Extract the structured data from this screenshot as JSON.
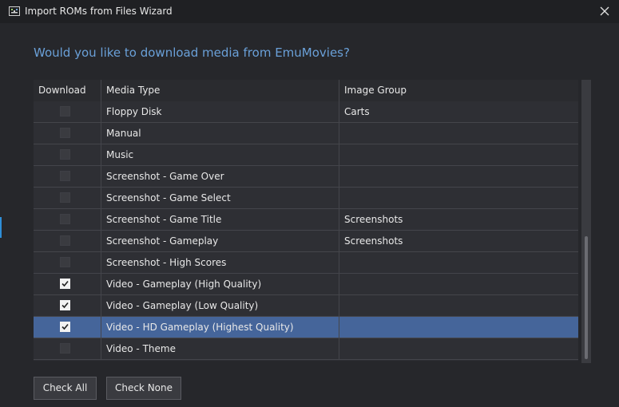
{
  "window": {
    "title": "Import ROMs from Files Wizard",
    "icon": "app-icon",
    "close_icon": "close-icon"
  },
  "question": "Would you like to download media from EmuMovies?",
  "table": {
    "columns": [
      "Download",
      "Media Type",
      "Image Group"
    ],
    "rows": [
      {
        "checked": false,
        "media_type": "Floppy Disk",
        "image_group": "Carts"
      },
      {
        "checked": false,
        "media_type": "Manual",
        "image_group": ""
      },
      {
        "checked": false,
        "media_type": "Music",
        "image_group": ""
      },
      {
        "checked": false,
        "media_type": "Screenshot - Game Over",
        "image_group": ""
      },
      {
        "checked": false,
        "media_type": "Screenshot - Game Select",
        "image_group": ""
      },
      {
        "checked": false,
        "media_type": "Screenshot - Game Title",
        "image_group": "Screenshots"
      },
      {
        "checked": false,
        "media_type": "Screenshot - Gameplay",
        "image_group": "Screenshots"
      },
      {
        "checked": false,
        "media_type": "Screenshot - High Scores",
        "image_group": ""
      },
      {
        "checked": true,
        "media_type": "Video - Gameplay (High Quality)",
        "image_group": ""
      },
      {
        "checked": true,
        "media_type": "Video - Gameplay (Low Quality)",
        "image_group": ""
      },
      {
        "checked": true,
        "media_type": "Video - HD Gameplay (Highest Quality)",
        "image_group": "",
        "selected": true
      },
      {
        "checked": false,
        "media_type": "Video - Theme",
        "image_group": ""
      }
    ]
  },
  "buttons": {
    "check_all": "Check All",
    "check_none": "Check None"
  },
  "colors": {
    "accent": "#6aa0d8",
    "selection": "#45659a",
    "background": "#26272b"
  }
}
